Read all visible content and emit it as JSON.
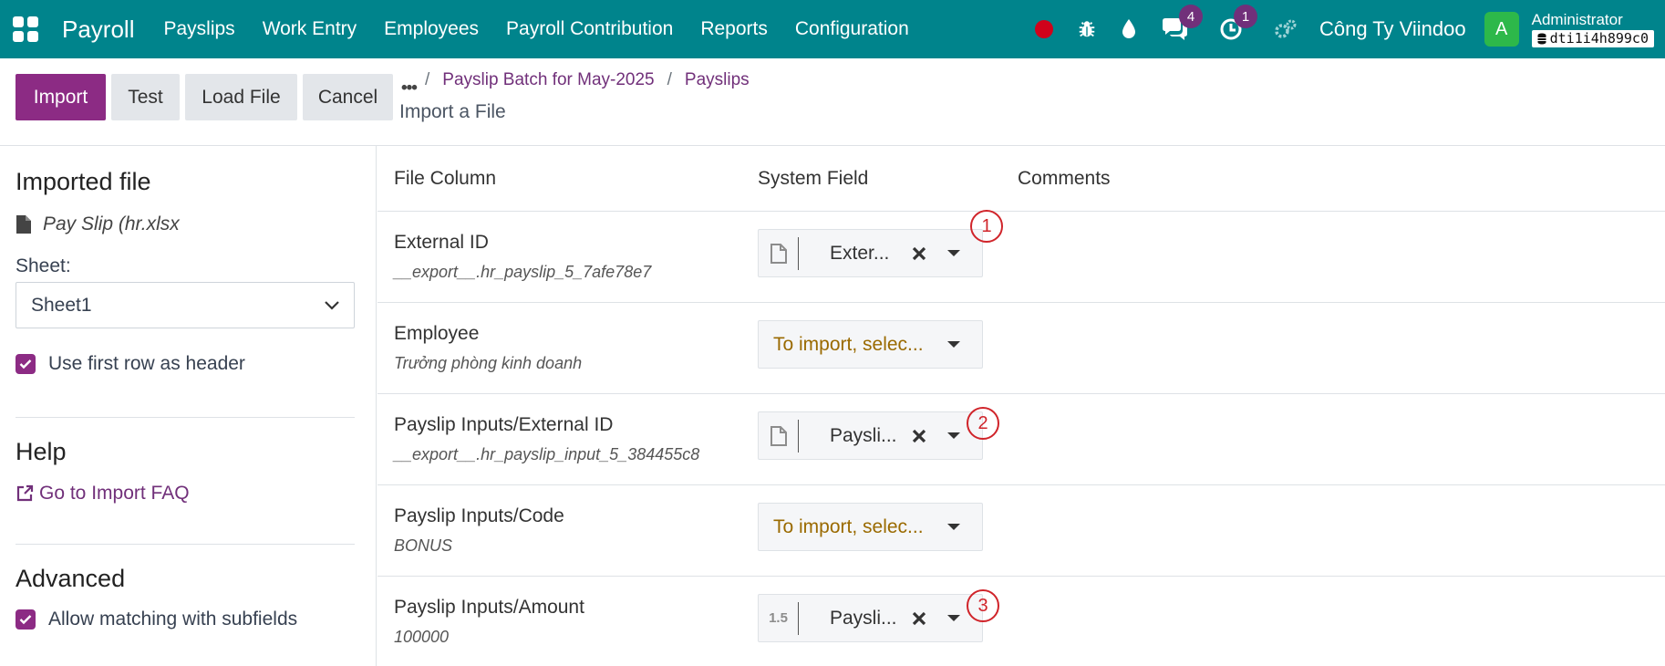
{
  "navbar": {
    "brand": "Payroll",
    "menu": [
      "Payslips",
      "Work Entry",
      "Employees",
      "Payroll Contribution",
      "Reports",
      "Configuration"
    ],
    "messages_count": "4",
    "activities_count": "1",
    "company": "Công Ty Viindoo",
    "avatar_letter": "A",
    "user_name": "Administrator",
    "db_name": "dti1i4h899c0"
  },
  "control": {
    "import_label": "Import",
    "test_label": "Test",
    "load_file_label": "Load File",
    "cancel_label": "Cancel",
    "breadcrumb": [
      "Payslip Batch for May-2025",
      "Payslips"
    ],
    "page_title": "Import a File"
  },
  "left_panel": {
    "imported_file_title": "Imported file",
    "file_name": "Pay Slip (hr.xlsx",
    "sheet_label": "Sheet:",
    "sheet_value": "Sheet1",
    "first_row_header_label": "Use first row as header",
    "help_title": "Help",
    "faq_link": "Go to Import FAQ",
    "advanced_title": "Advanced",
    "subfields_label": "Allow matching with subfields"
  },
  "table": {
    "headers": [
      "File Column",
      "System Field",
      "Comments"
    ],
    "rows": [
      {
        "column": "External ID",
        "sample": "__export__.hr_payslip_5_7afe78e7",
        "field": "Exter...",
        "type": "file",
        "marker": "1"
      },
      {
        "column": "Employee",
        "sample": "Trưởng phòng kinh doanh",
        "placeholder": "To import, selec..."
      },
      {
        "column": "Payslip Inputs/External ID",
        "sample": "__export__.hr_payslip_input_5_384455c8",
        "field": "Paysli...",
        "type": "file",
        "marker": "2"
      },
      {
        "column": "Payslip Inputs/Code",
        "sample": "BONUS",
        "placeholder": "To import, selec..."
      },
      {
        "column": "Payslip Inputs/Amount",
        "sample": "100000",
        "field": "Paysli...",
        "type": "1.5",
        "marker": "3"
      }
    ]
  }
}
